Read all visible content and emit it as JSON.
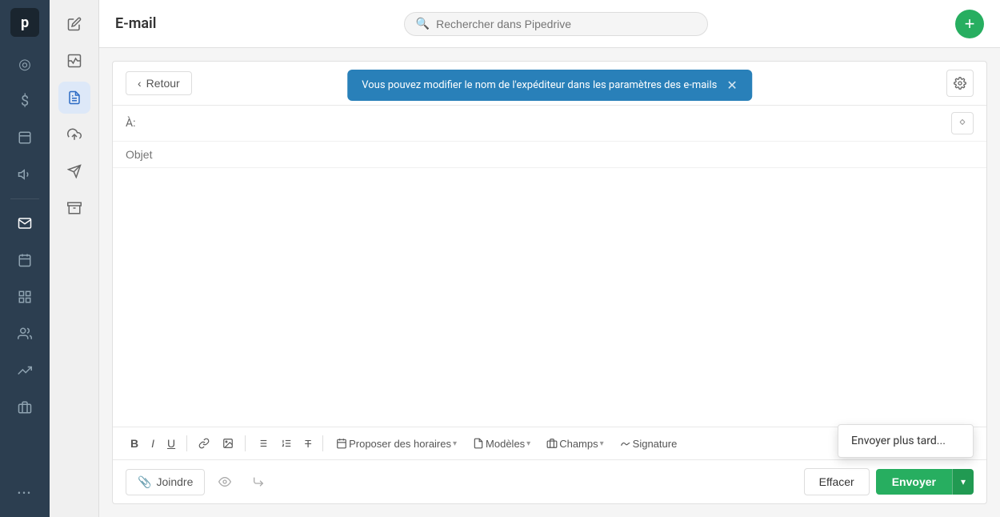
{
  "app": {
    "title": "E-mail"
  },
  "search": {
    "placeholder": "Rechercher dans Pipedrive"
  },
  "nav": {
    "logo": "p",
    "items": [
      {
        "id": "focus",
        "icon": "◎",
        "label": "Focus"
      },
      {
        "id": "deals",
        "icon": "💲",
        "label": "Deals"
      },
      {
        "id": "inbox",
        "icon": "☐",
        "label": "Inbox"
      },
      {
        "id": "campaigns",
        "icon": "📢",
        "label": "Campaigns"
      },
      {
        "id": "compose",
        "icon": "📋",
        "label": "Compose",
        "active": true
      },
      {
        "id": "email",
        "icon": "✉",
        "label": "Email",
        "navActive": true
      },
      {
        "id": "calendar",
        "icon": "📅",
        "label": "Calendar"
      },
      {
        "id": "reports",
        "icon": "📊",
        "label": "Reports"
      },
      {
        "id": "contacts",
        "icon": "👤",
        "label": "Contacts"
      },
      {
        "id": "chart",
        "icon": "📈",
        "label": "Chart"
      },
      {
        "id": "briefcase",
        "icon": "💼",
        "label": "Briefcase"
      },
      {
        "id": "more",
        "icon": "•••",
        "label": "More"
      }
    ]
  },
  "secondary_nav": {
    "items": [
      {
        "id": "compose-new",
        "icon": "✏",
        "label": "Compose new",
        "active": false
      },
      {
        "id": "template",
        "icon": "☐",
        "label": "Template"
      },
      {
        "id": "compose-active",
        "icon": "📋",
        "label": "Compose active",
        "active": true
      },
      {
        "id": "outbox",
        "icon": "📤",
        "label": "Outbox"
      },
      {
        "id": "sent",
        "icon": "➤",
        "label": "Sent"
      },
      {
        "id": "archive",
        "icon": "▬",
        "label": "Archive"
      }
    ]
  },
  "compose": {
    "back_label": "Retour",
    "notification": "Vous pouvez modifier le nom de l'expéditeur dans les paramètres des e-mails",
    "to_label": "À:",
    "subject_placeholder": "Objet",
    "toolbar": {
      "bold": "B",
      "italic": "I",
      "underline": "U",
      "schedule_label": "Proposer des horaires",
      "templates_label": "Modèles",
      "fields_label": "Champs",
      "signature_label": "Signature"
    },
    "attach_label": "Joindre",
    "clear_label": "Effacer",
    "send_label": "Envoyer",
    "send_later_label": "Envoyer plus tard..."
  }
}
